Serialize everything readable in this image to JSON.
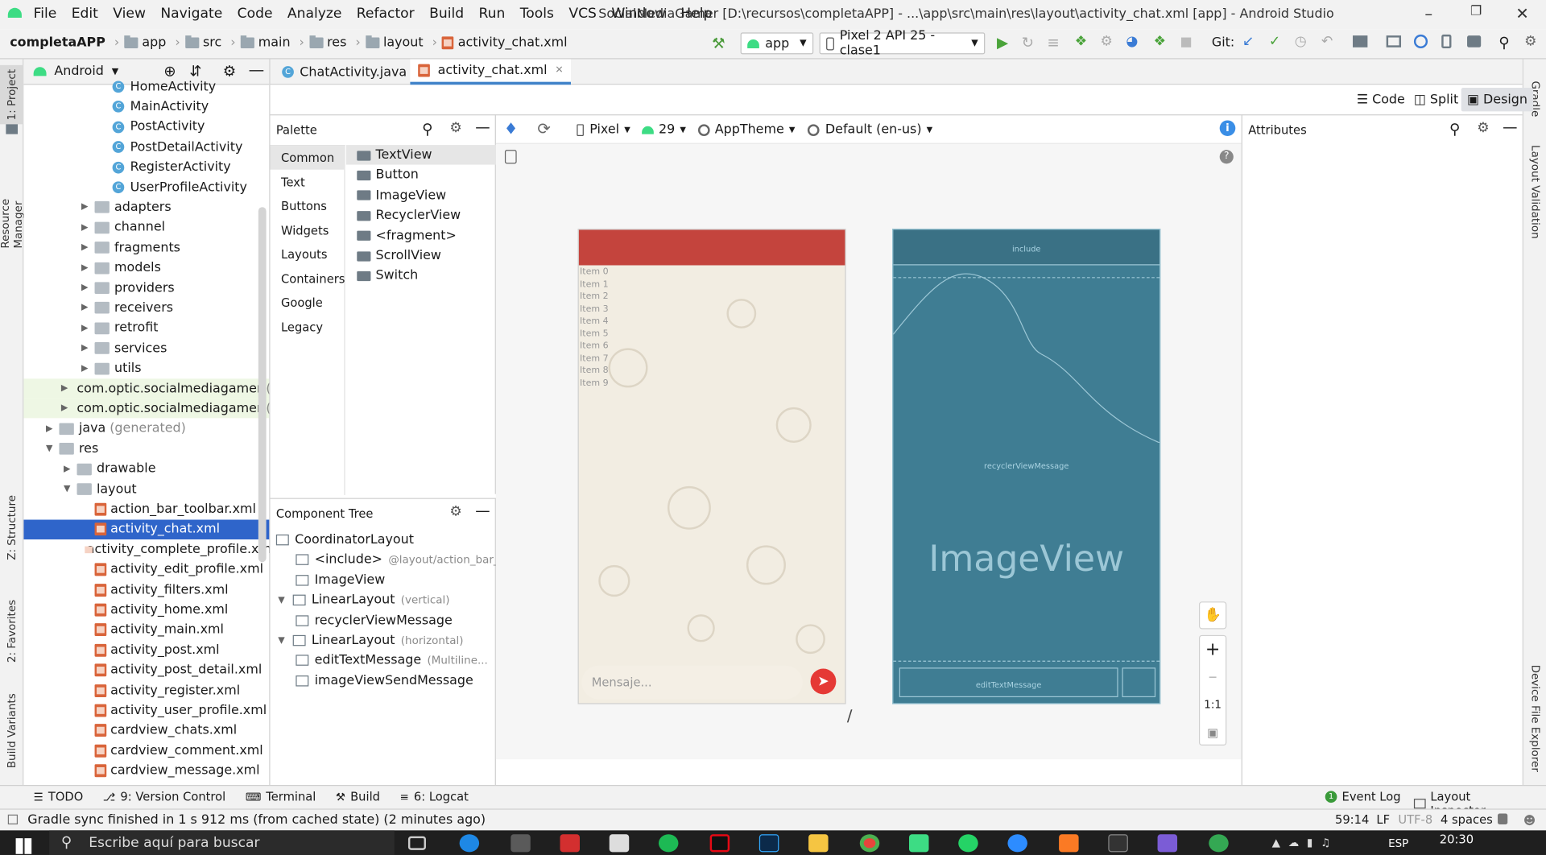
{
  "title_bar": {
    "menus": [
      "File",
      "Edit",
      "View",
      "Navigate",
      "Code",
      "Analyze",
      "Refactor",
      "Build",
      "Run",
      "Tools",
      "VCS",
      "Window",
      "Help"
    ],
    "title": "SocialMediaGamer [D:\\recursos\\completaAPP] - ...\\app\\src\\main\\res\\layout\\activity_chat.xml [app] - Android Studio"
  },
  "breadcrumbs": [
    "completaAPP",
    "app",
    "src",
    "main",
    "res",
    "layout",
    "activity_chat.xml"
  ],
  "toolbar": {
    "run_config": "app",
    "device": "Pixel 2 API 25 - clase1",
    "git_label": "Git:"
  },
  "left_tool_tabs": [
    "1: Project",
    "Resource Manager",
    "Z: Structure",
    "2: Favorites",
    "Build Variants"
  ],
  "right_tool_tabs": [
    "Gradle",
    "Layout Validation",
    "Device File Explorer"
  ],
  "project_panel": {
    "view_label": "Android",
    "rows": [
      {
        "label": "HomeActivity",
        "type": "class",
        "indent": 5
      },
      {
        "label": "MainActivity",
        "type": "class",
        "indent": 5
      },
      {
        "label": "PostActivity",
        "type": "class",
        "indent": 5
      },
      {
        "label": "PostDetailActivity",
        "type": "class",
        "indent": 5
      },
      {
        "label": "RegisterActivity",
        "type": "class",
        "indent": 5
      },
      {
        "label": "UserProfileActivity",
        "type": "class",
        "indent": 5
      },
      {
        "label": "adapters",
        "type": "folder",
        "indent": 4
      },
      {
        "label": "channel",
        "type": "folder",
        "indent": 4
      },
      {
        "label": "fragments",
        "type": "folder",
        "indent": 4
      },
      {
        "label": "models",
        "type": "folder",
        "indent": 4
      },
      {
        "label": "providers",
        "type": "folder",
        "indent": 4
      },
      {
        "label": "receivers",
        "type": "folder",
        "indent": 4
      },
      {
        "label": "retrofit",
        "type": "folder",
        "indent": 4
      },
      {
        "label": "services",
        "type": "folder",
        "indent": 4
      },
      {
        "label": "utils",
        "type": "folder",
        "indent": 4
      },
      {
        "label": "com.optic.socialmediagamer",
        "suffix": "(ar",
        "type": "pkg",
        "indent": 3
      },
      {
        "label": "com.optic.socialmediagamer",
        "suffix": "(te",
        "type": "pkg",
        "indent": 3
      },
      {
        "label": "java",
        "suffix": "(generated)",
        "type": "folder",
        "indent": 2
      },
      {
        "label": "res",
        "type": "folder-open",
        "indent": 2
      },
      {
        "label": "drawable",
        "type": "folder",
        "indent": 3
      },
      {
        "label": "layout",
        "type": "folder-open",
        "indent": 3
      },
      {
        "label": "action_bar_toolbar.xml",
        "type": "xml",
        "indent": 4
      },
      {
        "label": "activity_chat.xml",
        "type": "xml",
        "indent": 4,
        "selected": true
      },
      {
        "label": "activity_complete_profile.xml",
        "type": "xml",
        "indent": 4
      },
      {
        "label": "activity_edit_profile.xml",
        "type": "xml",
        "indent": 4
      },
      {
        "label": "activity_filters.xml",
        "type": "xml",
        "indent": 4
      },
      {
        "label": "activity_home.xml",
        "type": "xml",
        "indent": 4
      },
      {
        "label": "activity_main.xml",
        "type": "xml",
        "indent": 4
      },
      {
        "label": "activity_post.xml",
        "type": "xml",
        "indent": 4
      },
      {
        "label": "activity_post_detail.xml",
        "type": "xml",
        "indent": 4
      },
      {
        "label": "activity_register.xml",
        "type": "xml",
        "indent": 4
      },
      {
        "label": "activity_user_profile.xml",
        "type": "xml",
        "indent": 4
      },
      {
        "label": "cardview_chats.xml",
        "type": "xml",
        "indent": 4
      },
      {
        "label": "cardview_comment.xml",
        "type": "xml",
        "indent": 4
      },
      {
        "label": "cardview_message.xml",
        "type": "xml",
        "indent": 4
      }
    ]
  },
  "editor_tabs": [
    {
      "label": "ChatActivity.java",
      "active": false
    },
    {
      "label": "activity_chat.xml",
      "active": true
    }
  ],
  "view_modes": [
    "Code",
    "Split",
    "Design"
  ],
  "palette": {
    "title": "Palette",
    "categories": [
      "Common",
      "Text",
      "Buttons",
      "Widgets",
      "Layouts",
      "Containers",
      "Google",
      "Legacy"
    ],
    "items": [
      "TextView",
      "Button",
      "ImageView",
      "RecyclerView",
      "<fragment>",
      "ScrollView",
      "Switch"
    ]
  },
  "design_bar": {
    "device": "Pixel",
    "api": "29",
    "theme": "AppTheme",
    "locale": "Default (en-us)"
  },
  "attributes_title": "Attributes",
  "component_tree": {
    "title": "Component Tree",
    "rows": [
      {
        "label": "CoordinatorLayout",
        "hint": ""
      },
      {
        "label": "<include>",
        "hint": "@layout/action_bar_..."
      },
      {
        "label": "ImageView",
        "hint": ""
      },
      {
        "label": "LinearLayout",
        "hint": "(vertical)"
      },
      {
        "label": "recyclerViewMessage",
        "hint": ""
      },
      {
        "label": "LinearLayout",
        "hint": "(horizontal)"
      },
      {
        "label": "editTextMessage",
        "hint": "(Multiline..."
      },
      {
        "label": "imageViewSendMessage",
        "hint": ""
      }
    ]
  },
  "phone_preview": {
    "list_items": [
      "Item 0",
      "Item 1",
      "Item 2",
      "Item 3",
      "Item 4",
      "Item 5",
      "Item 6",
      "Item 7",
      "Item 8",
      "Item 9"
    ],
    "message_placeholder": "Mensaje..."
  },
  "blueprint": {
    "include_label": "include",
    "recycler_label": "recyclerViewMessage",
    "image_label": "ImageView",
    "edit_label": "editTextMessage"
  },
  "zoom_controls": {
    "reset": "1:1"
  },
  "bottom_tools": {
    "left": [
      "TODO",
      "9: Version Control",
      "Terminal",
      "Build",
      "6: Logcat"
    ],
    "right": [
      "Event Log",
      "Layout Inspector"
    ]
  },
  "status": {
    "message": "Gradle sync finished in 1 s 912 ms (from cached state) (2 minutes ago)",
    "position": "59:14",
    "line_sep": "LF",
    "encoding": "UTF-8",
    "indent": "4 spaces"
  },
  "taskbar": {
    "search_placeholder": "Escribe aquí para buscar",
    "lang": "ESP",
    "time": "20:30"
  },
  "colors": {
    "toolbar_red": "#c4443d",
    "blueprint": "#3f7d93",
    "selection": "#2f65ca",
    "send_button": "#e53935"
  }
}
